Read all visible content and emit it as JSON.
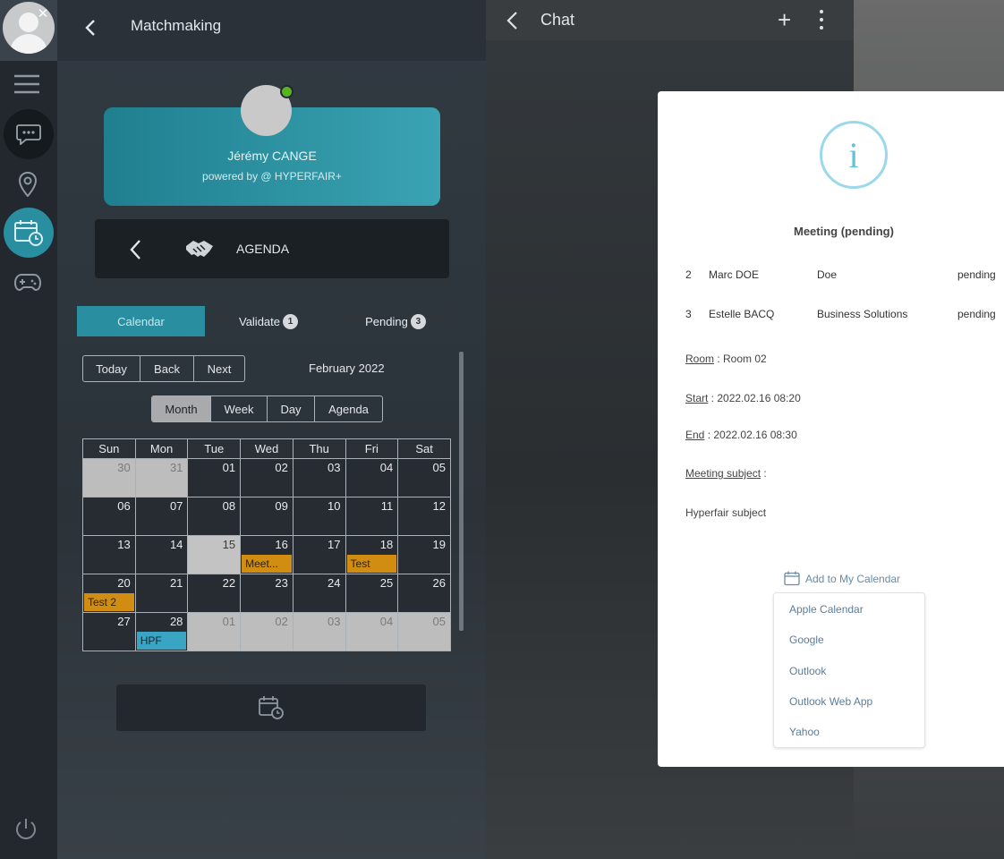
{
  "rail": {
    "items": [
      "menu",
      "chat",
      "location",
      "calendar",
      "games"
    ]
  },
  "matchmaking": {
    "title": "Matchmaking",
    "profile": {
      "name": "Jérémy CANGE",
      "powered_by": "powered by @ HYPERFAIR+"
    },
    "agenda_label": "AGENDA",
    "tabs": {
      "calendar": "Calendar",
      "validate": "Validate",
      "validate_count": "1",
      "pending": "Pending",
      "pending_count": "3"
    },
    "nav_buttons": [
      "Today",
      "Back",
      "Next"
    ],
    "month_label": "February 2022",
    "views": [
      "Month",
      "Week",
      "Day",
      "Agenda"
    ],
    "active_view": "Month",
    "weekdays": [
      "Sun",
      "Mon",
      "Tue",
      "Wed",
      "Thu",
      "Fri",
      "Sat"
    ],
    "weeks": [
      [
        {
          "d": "30",
          "off": true
        },
        {
          "d": "31",
          "off": true
        },
        {
          "d": "01"
        },
        {
          "d": "02"
        },
        {
          "d": "03"
        },
        {
          "d": "04"
        },
        {
          "d": "05"
        }
      ],
      [
        {
          "d": "06"
        },
        {
          "d": "07"
        },
        {
          "d": "08"
        },
        {
          "d": "09"
        },
        {
          "d": "10"
        },
        {
          "d": "11"
        },
        {
          "d": "12"
        }
      ],
      [
        {
          "d": "13"
        },
        {
          "d": "14"
        },
        {
          "d": "15",
          "today": true
        },
        {
          "d": "16",
          "event": "Meet...",
          "color": "orange"
        },
        {
          "d": "17"
        },
        {
          "d": "18",
          "event": "Test",
          "color": "orange"
        },
        {
          "d": "19"
        }
      ],
      [
        {
          "d": "20",
          "event": "Test 2",
          "color": "orange"
        },
        {
          "d": "21"
        },
        {
          "d": "22"
        },
        {
          "d": "23"
        },
        {
          "d": "24"
        },
        {
          "d": "25"
        },
        {
          "d": "26"
        }
      ],
      [
        {
          "d": "27"
        },
        {
          "d": "28",
          "event": "HPF",
          "color": "blue"
        },
        {
          "d": "01",
          "off": true
        },
        {
          "d": "02",
          "off": true
        },
        {
          "d": "03",
          "off": true
        },
        {
          "d": "04",
          "off": true
        },
        {
          "d": "05",
          "off": true
        }
      ]
    ]
  },
  "chat": {
    "title": "Chat"
  },
  "modal": {
    "title": "Meeting (pending)",
    "participants": [
      {
        "num": "2",
        "name": "Marc DOE",
        "company": "Doe",
        "status": "pending"
      },
      {
        "num": "3",
        "name": "Estelle BACQ",
        "company": "Business Solutions",
        "status": "pending"
      }
    ],
    "room_label": "Room",
    "room_value": " : Room 02",
    "start_label": "Start",
    "start_value": " : 2022.02.16 08:20",
    "end_label": "End",
    "end_value": " : 2022.02.16 08:30",
    "subject_label": "Meeting subject",
    "subject_suffix": " :",
    "subject_value": "Hyperfair subject",
    "add_to_calendar": "Add to My Calendar",
    "calendar_options": [
      "Apple Calendar",
      "Google",
      "Outlook",
      "Outlook Web App",
      "Yahoo"
    ]
  }
}
